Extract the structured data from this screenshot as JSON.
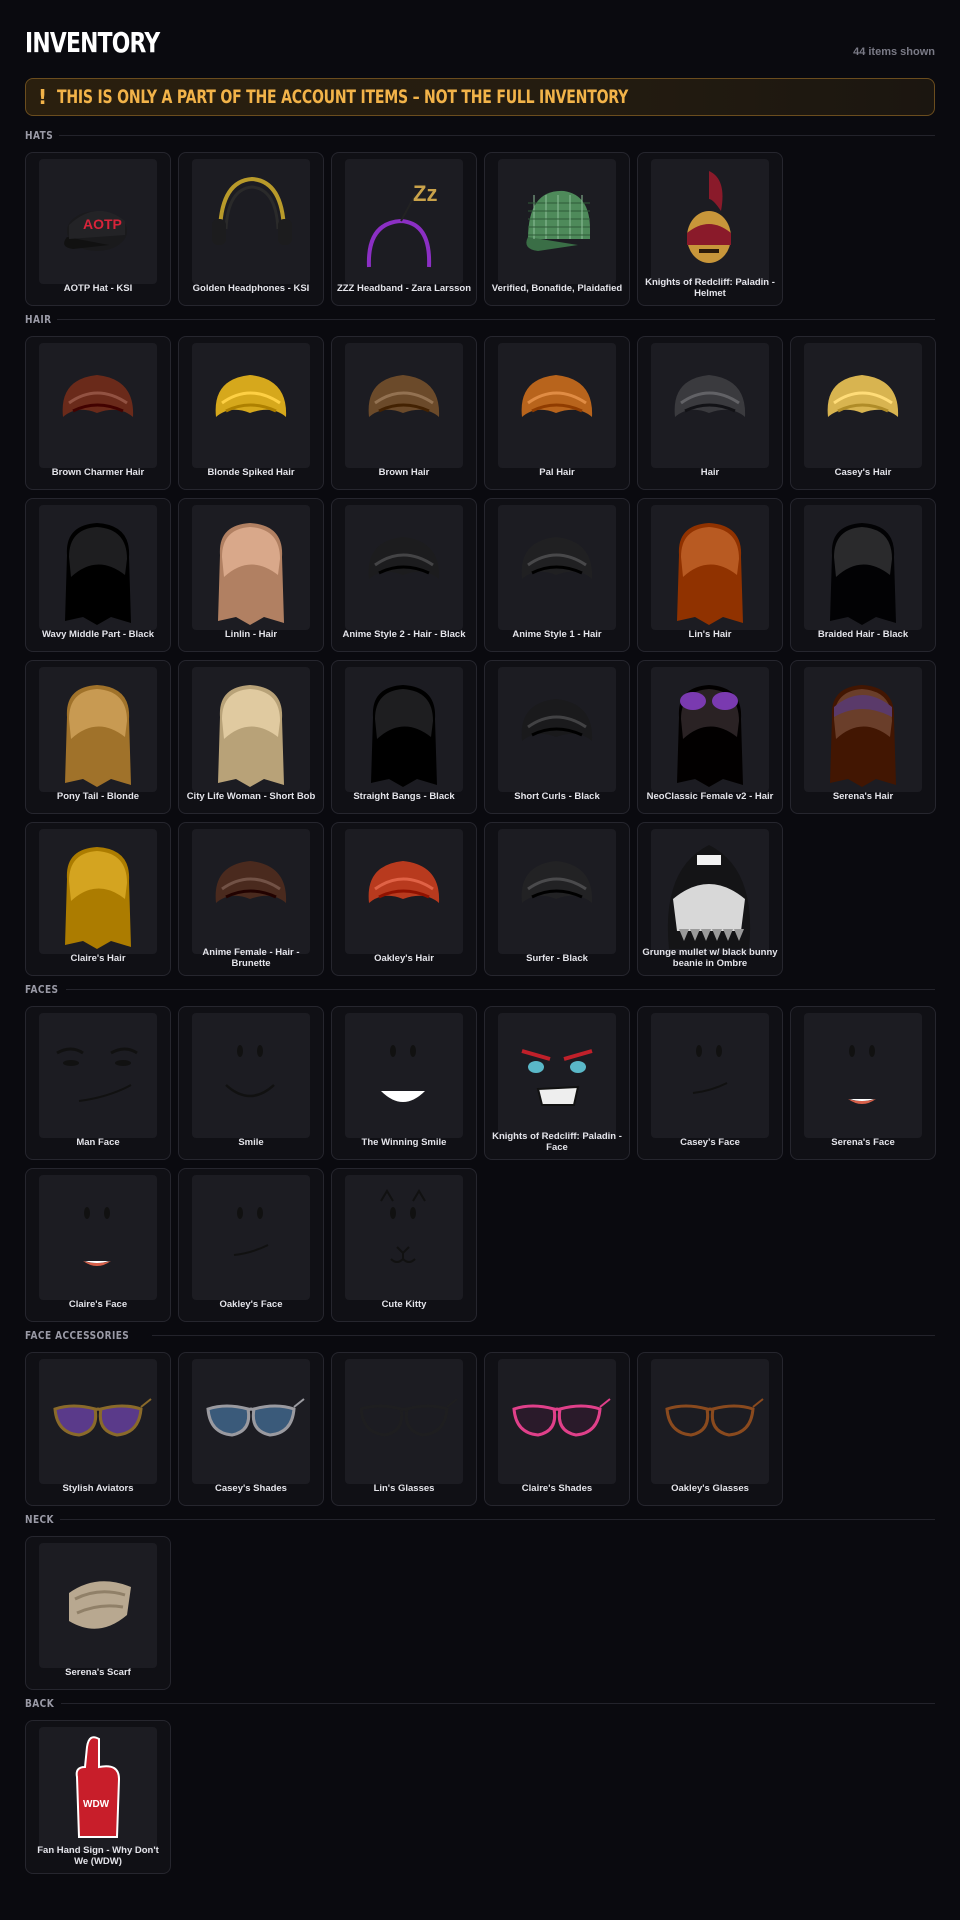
{
  "header": {
    "title": "INVENTORY",
    "count": "44 items shown"
  },
  "banner": {
    "icon": "!",
    "text": "THIS IS ONLY A PART OF THE ACCOUNT ITEMS – NOT THE FULL INVENTORY"
  },
  "sections": {
    "hats": {
      "title": "HATS",
      "items": [
        {
          "name": "AOTP Hat - KSI",
          "icon": "cap-icon"
        },
        {
          "name": "Golden Headphones - KSI",
          "icon": "headphones-icon"
        },
        {
          "name": "ZZZ Headband - Zara Larsson",
          "icon": "headband-icon"
        },
        {
          "name": "Verified, Bonafide, Plaidafied",
          "icon": "plaid-cap-icon"
        },
        {
          "name": "Knights of Redcliff: Paladin - Helmet",
          "icon": "helmet-icon"
        }
      ]
    },
    "hair": {
      "title": "HAIR",
      "items": [
        {
          "name": "Brown Charmer Hair",
          "icon": "hair-icon",
          "color": "#6a2a1a"
        },
        {
          "name": "Blonde Spiked Hair",
          "icon": "hair-icon",
          "color": "#d6a81c"
        },
        {
          "name": "Brown Hair",
          "icon": "hair-icon",
          "color": "#6b4a2a"
        },
        {
          "name": "Pal Hair",
          "icon": "hair-icon",
          "color": "#b8641c"
        },
        {
          "name": "Hair",
          "icon": "hair-icon",
          "color": "#3a3a3e"
        },
        {
          "name": "Casey's Hair",
          "icon": "hair-icon",
          "color": "#d8b450"
        },
        {
          "name": "Wavy Middle Part - Black",
          "icon": "hair-icon",
          "color": "#1e1e20"
        },
        {
          "name": "Linlin - Hair",
          "icon": "hair-icon",
          "color": "#d9a88a"
        },
        {
          "name": "Anime Style 2 - Hair - Black",
          "icon": "hair-icon",
          "color": "#1c1c1e"
        },
        {
          "name": "Anime Style 1 - Hair",
          "icon": "hair-icon",
          "color": "#202022"
        },
        {
          "name": "Lin's Hair",
          "icon": "hair-icon",
          "color": "#b85a22"
        },
        {
          "name": "Braided Hair - Black",
          "icon": "hair-icon",
          "color": "#2a2a2c"
        },
        {
          "name": "Pony Tail - Blonde",
          "icon": "hair-icon",
          "color": "#c89a52"
        },
        {
          "name": "City Life Woman - Short Bob",
          "icon": "hair-icon",
          "color": "#e0caa0"
        },
        {
          "name": "Straight Bangs - Black",
          "icon": "hair-icon",
          "color": "#1e1e20"
        },
        {
          "name": "Short Curls - Black",
          "icon": "hair-icon",
          "color": "#1a1a1c"
        },
        {
          "name": "NeoClassic Female v2 - Hair",
          "icon": "hair-icon",
          "color": "#2a2224"
        },
        {
          "name": "Serena's Hair",
          "icon": "hair-icon",
          "color": "#6a3e2a"
        },
        {
          "name": "Claire's Hair",
          "icon": "hair-icon",
          "color": "#d4a420"
        },
        {
          "name": "Anime Female - Hair - Brunette",
          "icon": "hair-icon",
          "color": "#4a2a1e"
        },
        {
          "name": "Oakley's Hair",
          "icon": "hair-icon",
          "color": "#b83a1e"
        },
        {
          "name": "Surfer - Black",
          "icon": "hair-icon",
          "color": "#222224"
        },
        {
          "name": "Grunge mullet w/ black bunny beanie in Ombre",
          "icon": "hair-icon",
          "color": "#d0d0d0"
        }
      ]
    },
    "faces": {
      "title": "FACES",
      "items": [
        {
          "name": "Man Face",
          "icon": "face-icon"
        },
        {
          "name": "Smile",
          "icon": "face-icon"
        },
        {
          "name": "The Winning Smile",
          "icon": "face-icon"
        },
        {
          "name": "Knights of Redcliff: Paladin - Face",
          "icon": "face-icon"
        },
        {
          "name": "Casey's Face",
          "icon": "face-icon"
        },
        {
          "name": "Serena's Face",
          "icon": "face-icon"
        },
        {
          "name": "Claire's Face",
          "icon": "face-icon"
        },
        {
          "name": "Oakley's Face",
          "icon": "face-icon"
        },
        {
          "name": "Cute Kitty",
          "icon": "face-icon"
        }
      ]
    },
    "face_accessories": {
      "title": "FACE ACCESSORIES",
      "items": [
        {
          "name": "Stylish Aviators",
          "icon": "glasses-icon",
          "color": "#8a6a2a"
        },
        {
          "name": "Casey's Shades",
          "icon": "glasses-icon",
          "color": "#9a9aa0"
        },
        {
          "name": "Lin's Glasses",
          "icon": "glasses-icon",
          "color": "#1e1e20"
        },
        {
          "name": "Claire's Shades",
          "icon": "glasses-icon",
          "color": "#e0408a"
        },
        {
          "name": "Oakley's Glasses",
          "icon": "glasses-icon",
          "color": "#8a4a1e"
        }
      ]
    },
    "neck": {
      "title": "NECK",
      "items": [
        {
          "name": "Serena's Scarf",
          "icon": "scarf-icon",
          "color": "#b8a890"
        }
      ]
    },
    "back": {
      "title": "BACK",
      "items": [
        {
          "name": "Fan Hand Sign - Why Don't We (WDW)",
          "icon": "foam-finger-icon",
          "color": "#c81e2a"
        }
      ]
    }
  }
}
